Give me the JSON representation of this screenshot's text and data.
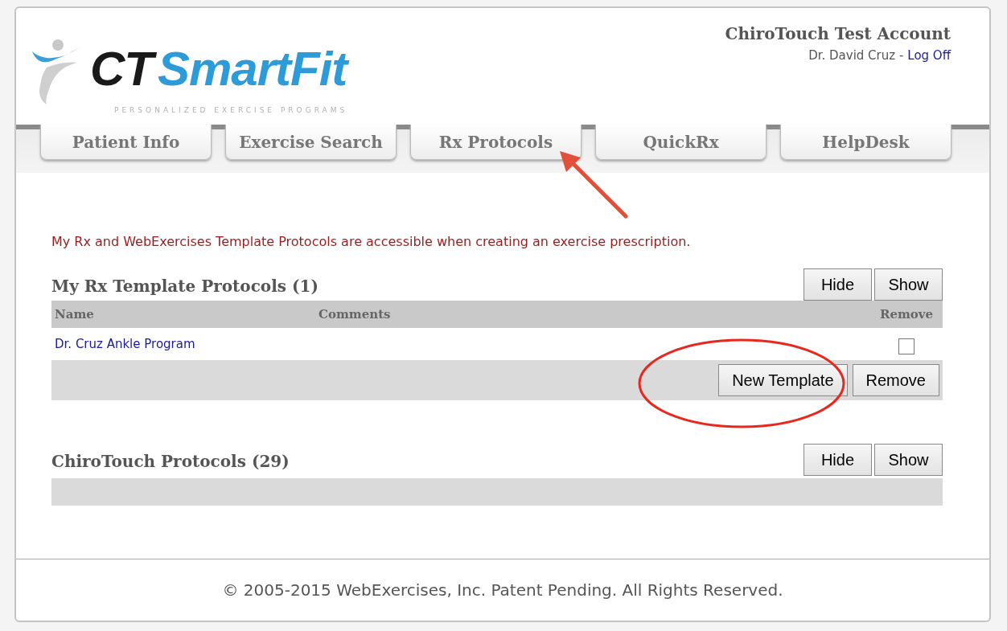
{
  "header": {
    "logo": {
      "prefix": "CT",
      "name": "SmartFit",
      "tagline": "PERSONALIZED EXERCISE PROGRAMS"
    },
    "account": "ChiroTouch Test Account",
    "user": "Dr. David Cruz -",
    "logoff": "Log Off"
  },
  "tabs": [
    {
      "label": "Patient Info"
    },
    {
      "label": "Exercise Search"
    },
    {
      "label": "Rx Protocols"
    },
    {
      "label": "QuickRx"
    },
    {
      "label": "HelpDesk"
    }
  ],
  "notice": "My Rx and WebExercises Template Protocols are accessible when creating an exercise prescription.",
  "sections": [
    {
      "title": "My Rx Template Protocols (1)",
      "buttons": [
        "Hide",
        "Show"
      ],
      "columns": [
        "Name",
        "Comments",
        "Remove"
      ],
      "rows": [
        {
          "name": "Dr. Cruz Ankle Program",
          "comments": "",
          "remove": false
        }
      ],
      "actions": [
        "New Template",
        "Remove"
      ]
    },
    {
      "title": "ChiroTouch Protocols (29)",
      "buttons": [
        "Hide",
        "Show"
      ]
    }
  ],
  "footer": "© 2005-2015 WebExercises, Inc. Patent Pending. All Rights Reserved."
}
